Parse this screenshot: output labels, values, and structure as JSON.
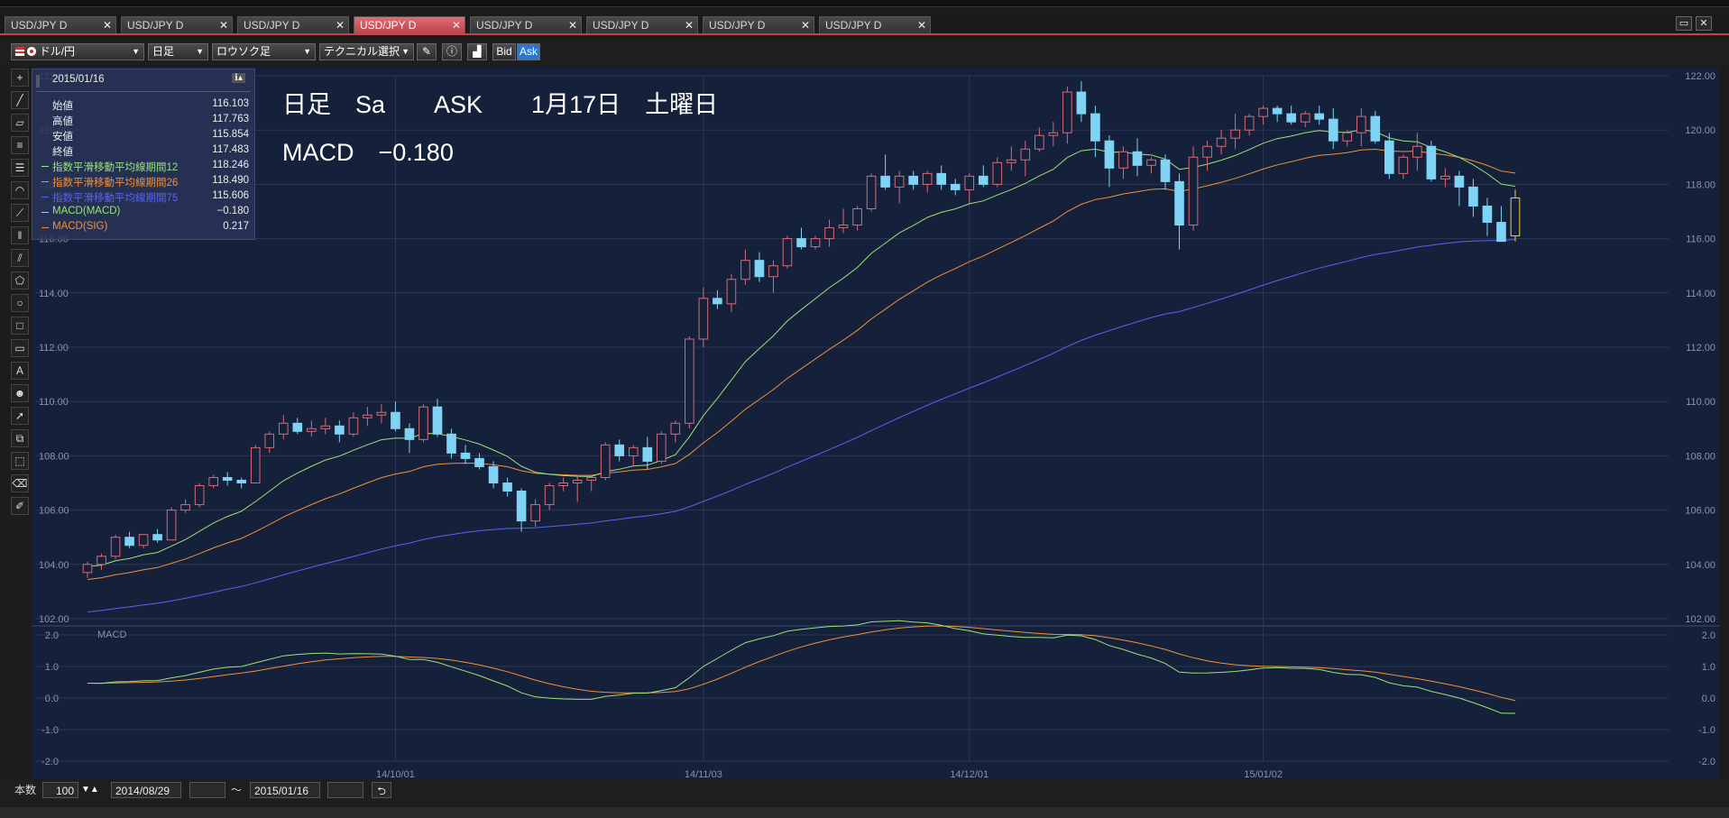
{
  "tabs": [
    {
      "label": "USD/JPY D",
      "active": false
    },
    {
      "label": "USD/JPY D",
      "active": false
    },
    {
      "label": "USD/JPY D",
      "active": false
    },
    {
      "label": "USD/JPY D",
      "active": true
    },
    {
      "label": "USD/JPY D",
      "active": false
    },
    {
      "label": "USD/JPY D",
      "active": false
    },
    {
      "label": "USD/JPY D",
      "active": false
    },
    {
      "label": "USD/JPY D",
      "active": false
    }
  ],
  "toolbar": {
    "currency_pair": "ドル/円",
    "timeframe": "日足",
    "chart_type": "ロウソク足",
    "technical_select": "テクニカル選択",
    "bid_label": "Bid",
    "ask_label": "Ask"
  },
  "info_panel": {
    "date": "2015/01/16",
    "rows": [
      {
        "label": "始値",
        "value": "116.103",
        "color": "#eeeeee"
      },
      {
        "label": "高値",
        "value": "117.763",
        "color": "#eeeeee"
      },
      {
        "label": "安値",
        "value": "115.854",
        "color": "#eeeeee"
      },
      {
        "label": "終値",
        "value": "117.483",
        "color": "#eeeeee"
      },
      {
        "label": "指数平滑移動平均線期間12",
        "value": "118.246",
        "color": "#9be27a"
      },
      {
        "label": "指数平滑移動平均線期間26",
        "value": "118.490",
        "color": "#f0913a"
      },
      {
        "label": "指数平滑移動平均線期間75",
        "value": "115.606",
        "color": "#5b63f0"
      },
      {
        "label": "MACD(MACD)",
        "value": "−0.180",
        "color": "#9be27a"
      },
      {
        "label": "MACD(SIG)",
        "value": "0.217",
        "color": "#f0913a"
      }
    ]
  },
  "overlay": {
    "line1": "日足　Sa　　ASK　　1月17日　土曜日",
    "line2": "MACD　−0.180"
  },
  "main_chart": {
    "y_ticks": [
      "122.00",
      "120.00",
      "118.00",
      "116.00",
      "114.00",
      "112.00",
      "110.00",
      "108.00",
      "106.00",
      "104.00",
      "102.00"
    ],
    "ylim": [
      102,
      122
    ]
  },
  "macd_chart": {
    "label": "MACD",
    "y_ticks": [
      "2.0",
      "1.0",
      "0.0",
      "-1.0",
      "-2.0"
    ],
    "ylim": [
      -2,
      2
    ]
  },
  "x_ticks": [
    "14/10/01",
    "14/11/03",
    "14/12/01",
    "15/01/02"
  ],
  "bottom": {
    "count_label": "本数",
    "count_value": "100",
    "start_date": "2014/08/29",
    "separator": "〜",
    "end_date": "2015/01/16"
  },
  "colors": {
    "up": "#d86a78",
    "down": "#7fd3f5",
    "current": "#e6d34a",
    "ema12": "#9be27a",
    "ema26": "#f0913a",
    "ema75": "#5b63f0",
    "macd": "#9be27a",
    "sig": "#f0913a"
  },
  "chart_data": {
    "type": "candlestick",
    "start_date": "2014/08/29",
    "end_date": "2015/01/16",
    "ylim": [
      102,
      122
    ],
    "bars": [
      [
        103.7,
        104.1,
        103.5,
        104.0
      ],
      [
        104.0,
        104.4,
        103.8,
        104.3
      ],
      [
        104.3,
        105.1,
        104.2,
        105.0
      ],
      [
        105.0,
        105.2,
        104.6,
        104.7
      ],
      [
        104.7,
        105.1,
        104.6,
        105.1
      ],
      [
        105.1,
        105.3,
        104.8,
        104.9
      ],
      [
        104.9,
        106.1,
        104.9,
        106.0
      ],
      [
        106.0,
        106.4,
        105.9,
        106.2
      ],
      [
        106.2,
        107.0,
        106.1,
        106.9
      ],
      [
        106.9,
        107.3,
        106.8,
        107.2
      ],
      [
        107.2,
        107.4,
        106.9,
        107.1
      ],
      [
        107.1,
        107.2,
        106.8,
        107.0
      ],
      [
        107.0,
        108.4,
        107.0,
        108.3
      ],
      [
        108.3,
        108.9,
        108.1,
        108.8
      ],
      [
        108.8,
        109.5,
        108.6,
        109.2
      ],
      [
        109.2,
        109.4,
        108.8,
        108.9
      ],
      [
        108.9,
        109.3,
        108.7,
        109.0
      ],
      [
        109.0,
        109.4,
        108.8,
        109.1
      ],
      [
        109.1,
        109.3,
        108.5,
        108.8
      ],
      [
        108.8,
        109.6,
        108.7,
        109.4
      ],
      [
        109.4,
        109.8,
        109.1,
        109.5
      ],
      [
        109.5,
        109.9,
        109.2,
        109.6
      ],
      [
        109.6,
        110.0,
        108.9,
        109.0
      ],
      [
        109.0,
        109.2,
        108.1,
        108.6
      ],
      [
        108.6,
        109.9,
        108.5,
        109.8
      ],
      [
        109.8,
        110.1,
        108.7,
        108.8
      ],
      [
        108.8,
        109.0,
        107.9,
        108.1
      ],
      [
        108.1,
        108.4,
        107.7,
        107.9
      ],
      [
        107.9,
        108.1,
        107.5,
        107.6
      ],
      [
        107.6,
        107.8,
        106.8,
        107.0
      ],
      [
        107.0,
        107.2,
        106.5,
        106.7
      ],
      [
        106.7,
        106.8,
        105.2,
        105.6
      ],
      [
        105.6,
        106.4,
        105.4,
        106.2
      ],
      [
        106.2,
        107.0,
        106.0,
        106.9
      ],
      [
        106.9,
        107.2,
        106.7,
        107.0
      ],
      [
        107.0,
        107.3,
        106.3,
        107.1
      ],
      [
        107.1,
        107.3,
        106.7,
        107.2
      ],
      [
        107.2,
        108.5,
        107.1,
        108.4
      ],
      [
        108.4,
        108.6,
        107.8,
        108.0
      ],
      [
        108.0,
        108.4,
        107.6,
        108.3
      ],
      [
        108.3,
        108.7,
        107.5,
        107.8
      ],
      [
        107.8,
        108.9,
        107.7,
        108.8
      ],
      [
        108.8,
        109.3,
        108.5,
        109.2
      ],
      [
        109.2,
        112.4,
        109.0,
        112.3
      ],
      [
        112.3,
        114.2,
        112.0,
        113.8
      ],
      [
        113.8,
        114.1,
        113.4,
        113.6
      ],
      [
        113.6,
        114.7,
        113.3,
        114.5
      ],
      [
        114.5,
        115.6,
        114.3,
        115.2
      ],
      [
        115.2,
        115.5,
        114.4,
        114.6
      ],
      [
        114.6,
        115.2,
        114.0,
        115.0
      ],
      [
        115.0,
        116.1,
        114.9,
        116.0
      ],
      [
        116.0,
        116.4,
        115.6,
        115.7
      ],
      [
        115.7,
        116.1,
        115.6,
        116.0
      ],
      [
        116.0,
        116.7,
        115.7,
        116.4
      ],
      [
        116.4,
        117.1,
        116.2,
        116.5
      ],
      [
        116.5,
        117.2,
        116.3,
        117.1
      ],
      [
        117.1,
        118.4,
        117.0,
        118.3
      ],
      [
        118.3,
        119.1,
        117.8,
        117.9
      ],
      [
        117.9,
        118.5,
        117.3,
        118.3
      ],
      [
        118.3,
        118.5,
        117.8,
        118.0
      ],
      [
        118.0,
        118.5,
        117.7,
        118.4
      ],
      [
        118.4,
        118.7,
        117.8,
        118.0
      ],
      [
        118.0,
        118.2,
        117.6,
        117.8
      ],
      [
        117.8,
        118.4,
        117.3,
        118.3
      ],
      [
        118.3,
        118.7,
        117.9,
        118.0
      ],
      [
        118.0,
        119.0,
        117.9,
        118.8
      ],
      [
        118.8,
        119.4,
        118.5,
        118.9
      ],
      [
        118.9,
        119.6,
        118.3,
        119.3
      ],
      [
        119.3,
        120.1,
        119.2,
        119.8
      ],
      [
        119.8,
        120.3,
        119.4,
        119.9
      ],
      [
        119.9,
        121.6,
        119.5,
        121.4
      ],
      [
        121.4,
        121.8,
        120.3,
        120.6
      ],
      [
        120.6,
        120.9,
        119.0,
        119.6
      ],
      [
        119.6,
        119.8,
        117.9,
        118.6
      ],
      [
        118.6,
        119.4,
        118.2,
        119.2
      ],
      [
        119.2,
        119.7,
        118.3,
        118.7
      ],
      [
        118.7,
        119.0,
        118.4,
        118.9
      ],
      [
        118.9,
        119.1,
        117.8,
        118.1
      ],
      [
        118.1,
        118.4,
        115.6,
        116.5
      ],
      [
        116.5,
        119.4,
        116.3,
        119.0
      ],
      [
        119.0,
        119.6,
        118.5,
        119.4
      ],
      [
        119.4,
        120.0,
        119.1,
        119.7
      ],
      [
        119.7,
        120.6,
        119.3,
        120.0
      ],
      [
        120.0,
        120.6,
        119.8,
        120.5
      ],
      [
        120.5,
        120.9,
        120.2,
        120.8
      ],
      [
        120.8,
        120.9,
        120.3,
        120.6
      ],
      [
        120.6,
        120.9,
        120.2,
        120.3
      ],
      [
        120.3,
        120.7,
        120.1,
        120.6
      ],
      [
        120.6,
        120.9,
        120.2,
        120.4
      ],
      [
        120.4,
        120.8,
        119.3,
        119.6
      ],
      [
        119.6,
        120.0,
        119.4,
        119.9
      ],
      [
        119.9,
        120.8,
        119.4,
        120.5
      ],
      [
        120.5,
        120.7,
        119.5,
        119.6
      ],
      [
        119.6,
        119.9,
        118.2,
        118.4
      ],
      [
        118.4,
        119.1,
        118.2,
        119.0
      ],
      [
        119.0,
        119.9,
        118.5,
        119.4
      ],
      [
        119.4,
        119.6,
        118.1,
        118.2
      ],
      [
        118.2,
        118.6,
        117.9,
        118.3
      ],
      [
        118.3,
        118.5,
        117.2,
        117.9
      ],
      [
        117.9,
        118.2,
        116.8,
        117.2
      ],
      [
        117.2,
        117.5,
        116.1,
        116.6
      ],
      [
        116.6,
        117.2,
        115.9,
        115.9
      ],
      [
        116.1,
        117.8,
        115.9,
        117.5
      ]
    ]
  }
}
